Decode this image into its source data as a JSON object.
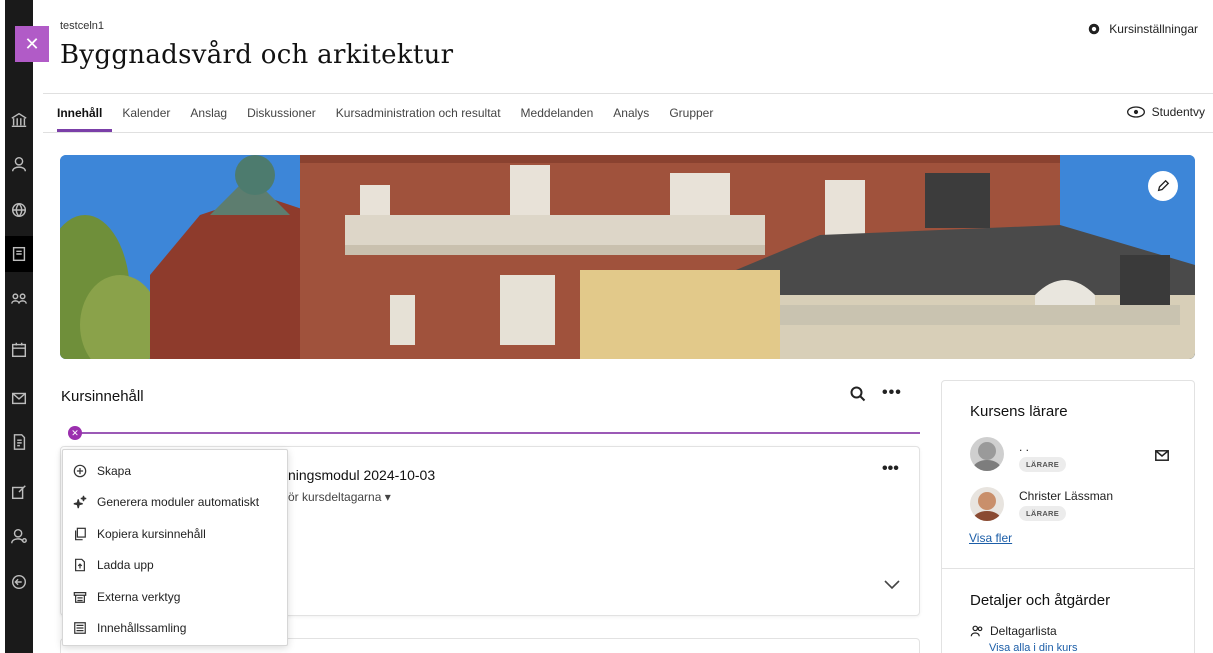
{
  "header": {
    "course_code": "testceln1",
    "course_title": "Byggnadsvård och arkitektur",
    "settings_label": "Kursinställningar"
  },
  "tabs": [
    {
      "label": "Innehåll",
      "active": true
    },
    {
      "label": "Kalender"
    },
    {
      "label": "Anslag"
    },
    {
      "label": "Diskussioner"
    },
    {
      "label": "Kursadministration och resultat"
    },
    {
      "label": "Meddelanden"
    },
    {
      "label": "Analys"
    },
    {
      "label": "Grupper"
    }
  ],
  "student_view_label": "Studentvy",
  "content": {
    "section_title": "Kursinnehåll",
    "more_label": "•••",
    "module_title": "ningsmodul 2024-10-03",
    "module_subtitle": "ör kursdeltagarna ▾",
    "module_more": "•••"
  },
  "menu": {
    "items": [
      {
        "label": "Skapa",
        "icon": "plus-circle-icon"
      },
      {
        "label": "Generera moduler automatiskt",
        "icon": "sparkle-icon"
      },
      {
        "label": "Kopiera kursinnehåll",
        "icon": "copy-icon"
      },
      {
        "label": "Ladda upp",
        "icon": "upload-file-icon"
      },
      {
        "label": "Externa verktyg",
        "icon": "store-icon"
      },
      {
        "label": "Innehållssamling",
        "icon": "collection-icon"
      }
    ]
  },
  "teachers": {
    "title": "Kursens lärare",
    "list": [
      {
        "name": ". .",
        "role": "LÄRARE"
      },
      {
        "name": "Christer Lässman",
        "role": "LÄRARE"
      }
    ],
    "see_more": "Visa fler"
  },
  "details": {
    "title": "Detaljer och åtgärder",
    "participants_label": "Deltagarlista",
    "participants_link": "Visa alla i din kurs"
  },
  "colors": {
    "accent": "#7b3fa8",
    "close_tab": "#b15bc7",
    "link": "#1c5ea8"
  }
}
